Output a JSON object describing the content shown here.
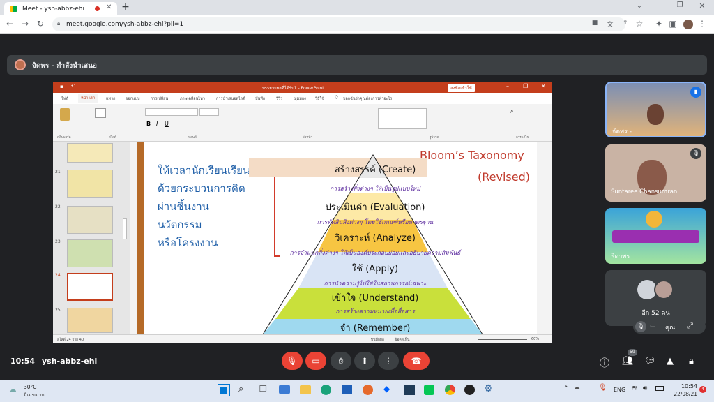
{
  "browser": {
    "tab_title": "Meet - ysh-abbz-ehi",
    "url": "meet.google.com/ysh-abbz-ehi?pli=1"
  },
  "meet": {
    "presenter_label": "จัดพร - กำลังนำเสนอ",
    "time": "10:54",
    "meeting_code": "ysh-abbz-ehi",
    "participants_badge": "59",
    "tiles": [
      {
        "name": "จัดพร -"
      },
      {
        "name": "Suntaree Chansumran"
      },
      {
        "name": "ธิดาพร"
      },
      {
        "name": "อีก 52 คน"
      }
    ],
    "you_label": "คุณ"
  },
  "powerpoint": {
    "title": "บรรยายผลที่ได้รับ1 - PowerPoint",
    "signin": "ลงชื่อเข้าใช้",
    "tabs": [
      "ไฟล์",
      "หน้าแรก",
      "แทรก",
      "ออกแบบ",
      "การเปลี่ยน",
      "ภาพเคลื่อนไหว",
      "การนำเสนอสไลด์",
      "บันทึก",
      "รีวิว",
      "มุมมอง",
      "วิธีใช้",
      "บอกฉันว่าคุณต้องการทำอะไร"
    ],
    "thumb_numbers": [
      "21",
      "22",
      "23",
      "24",
      "25"
    ],
    "status_left": "สไลด์ 24 จาก 40",
    "status_notes": "บันทึกย่อ",
    "status_comments": "ข้อคิดเห็น",
    "zoom": "60%",
    "ribbon_groups": [
      "คลิปบอร์ด",
      "สไลด์",
      "ฟอนต์",
      "ย่อหน้า",
      "รูปวาด",
      "การแก้ไข"
    ]
  },
  "slide": {
    "heading": "Bloom’s Taxonomy",
    "heading2": "(Revised)",
    "left_lines": [
      "ให้เวลานักเรียนเรียนรู้",
      "ด้วยกระบวนการคิด",
      "ผ่านชิ้นงาน",
      "นวัตกรรม",
      "หรือโครงงาน"
    ],
    "tiers": [
      {
        "name": "สร้างสรรค์ (Create)",
        "desc": "การสร้างสิ่งต่างๆ ให้เป็นรูปแบบใหม่",
        "color": "#e8e8e8"
      },
      {
        "name": "ประเมินค่า (Evaluation)",
        "desc": "การตัดสินสิ่งต่างๆ โดยใช้เกณฑ์หรือมาตรฐาน",
        "color": "#fde9a6"
      },
      {
        "name": "วิเคราะห์ (Analyze)",
        "desc": "การจำแนกสิ่งต่างๆ ให้เป็นองค์ประกอบย่อยและอธิบายความสัมพันธ์",
        "color": "#f7c542"
      },
      {
        "name": "ใช้ (Apply)",
        "desc": "การนำความรู้ไปใช้ในสถานการณ์เฉพาะ",
        "color": "#d9e4f5"
      },
      {
        "name": "เข้าใจ (Understand)",
        "desc": "การสร้างความหมายเพื่อสื่อสาร",
        "color": "#c9e03b"
      },
      {
        "name": "จำ (Remember)",
        "desc": "",
        "color": "#9fd9ef"
      }
    ]
  },
  "taskbar": {
    "weather_temp": "30°C",
    "weather_desc": "มีเมฆมาก",
    "lang": "ENG",
    "clock_time": "10:54",
    "clock_date": "22/08/21",
    "notif_count": "4"
  }
}
